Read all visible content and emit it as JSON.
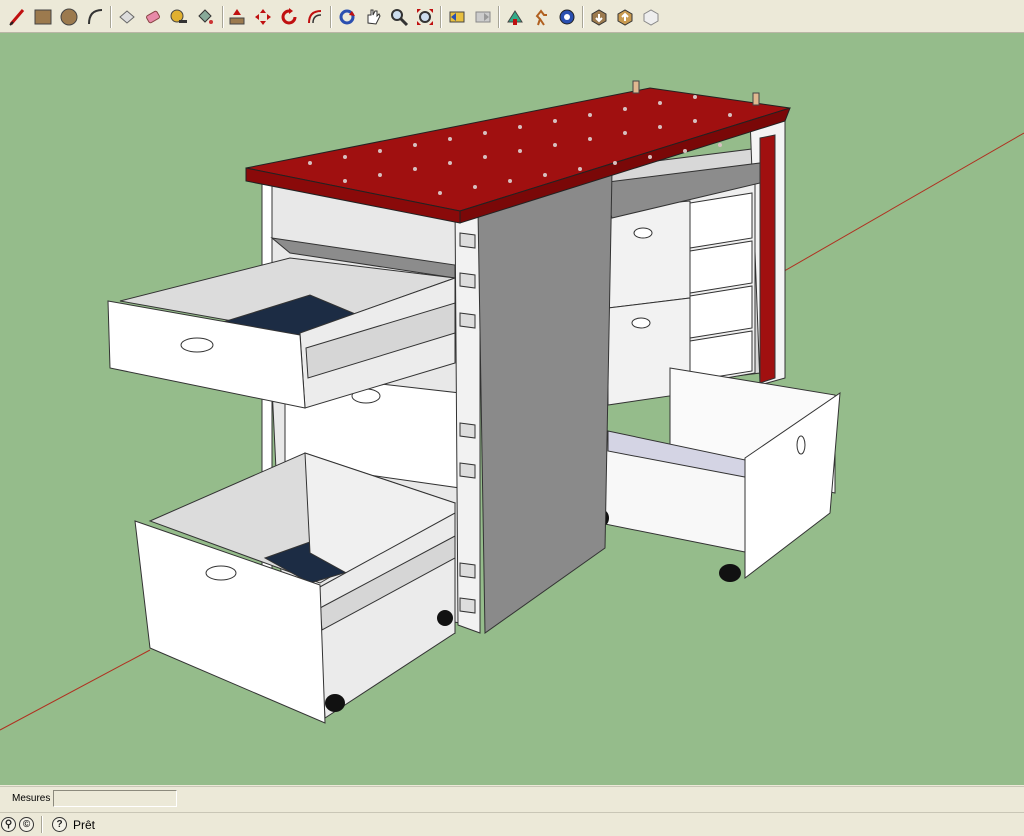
{
  "toolbar": {
    "tools": [
      {
        "name": "pencil-icon"
      },
      {
        "name": "rectangle-icon"
      },
      {
        "name": "circle-icon"
      },
      {
        "name": "arc-icon"
      },
      {
        "name": "select-icon"
      },
      {
        "name": "eraser-icon"
      },
      {
        "name": "tape-measure-icon"
      },
      {
        "name": "paint-bucket-icon"
      },
      {
        "name": "push-pull-icon"
      },
      {
        "name": "move-icon"
      },
      {
        "name": "rotate-icon"
      },
      {
        "name": "offset-icon"
      },
      {
        "name": "orbit-icon"
      },
      {
        "name": "pan-icon"
      },
      {
        "name": "zoom-icon"
      },
      {
        "name": "zoom-extents-icon"
      },
      {
        "name": "previous-view-icon"
      },
      {
        "name": "next-view-icon"
      },
      {
        "name": "position-camera-icon"
      },
      {
        "name": "walk-icon"
      },
      {
        "name": "look-around-icon"
      },
      {
        "name": "get-models-icon"
      },
      {
        "name": "share-model-icon"
      },
      {
        "name": "components-icon"
      }
    ]
  },
  "measurements": {
    "label": "Mesures",
    "value": ""
  },
  "status": {
    "text": "Prêt"
  },
  "colors": {
    "viewport_bg": "#95bc8b",
    "tabletop": "#a01010",
    "cabinet": "#ffffff"
  }
}
